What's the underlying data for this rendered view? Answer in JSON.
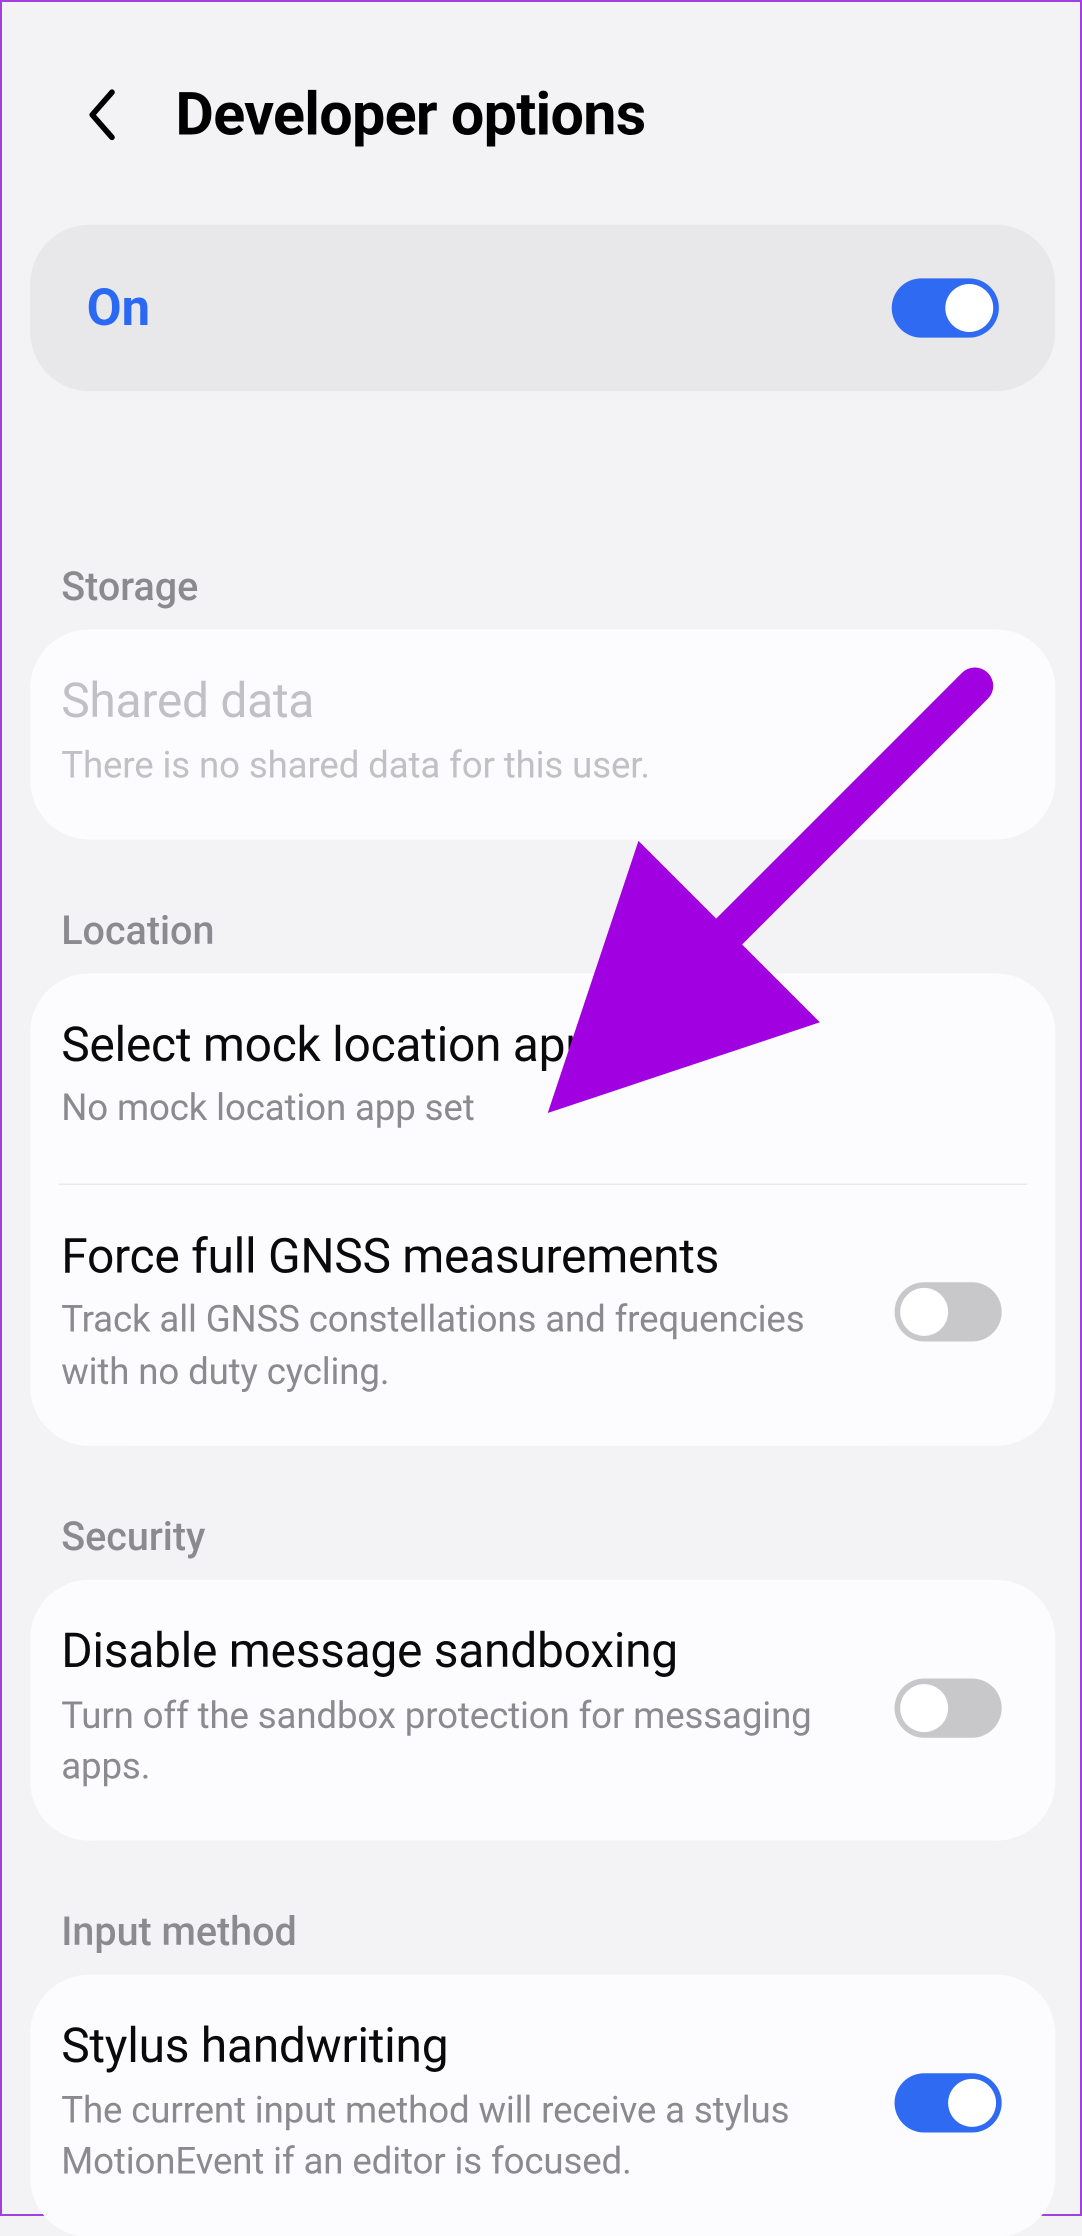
{
  "header": {
    "title": "Developer options"
  },
  "master": {
    "label": "On",
    "toggle_state": "on"
  },
  "sections": {
    "storage": {
      "label": "Storage",
      "shared_data": {
        "title": "Shared data",
        "sub": "There is no shared data for this user."
      }
    },
    "location": {
      "label": "Location",
      "mock": {
        "title": "Select mock location app",
        "sub": "No mock location app set"
      },
      "gnss": {
        "title": "Force full GNSS measurements",
        "sub": "Track all GNSS constellations and frequencies with no duty cycling.",
        "toggle_state": "off"
      }
    },
    "security": {
      "label": "Security",
      "sandbox": {
        "title": "Disable message sandboxing",
        "sub": "Turn off the sandbox protection for messaging apps.",
        "toggle_state": "off"
      }
    },
    "input": {
      "label": "Input method",
      "stylus": {
        "title": "Stylus handwriting",
        "sub": "The current input method will receive a stylus MotionEvent if an editor is focused.",
        "toggle_state": "on"
      }
    }
  },
  "colors": {
    "accent": "#2f6bf2",
    "arrow": "#a100e0"
  }
}
